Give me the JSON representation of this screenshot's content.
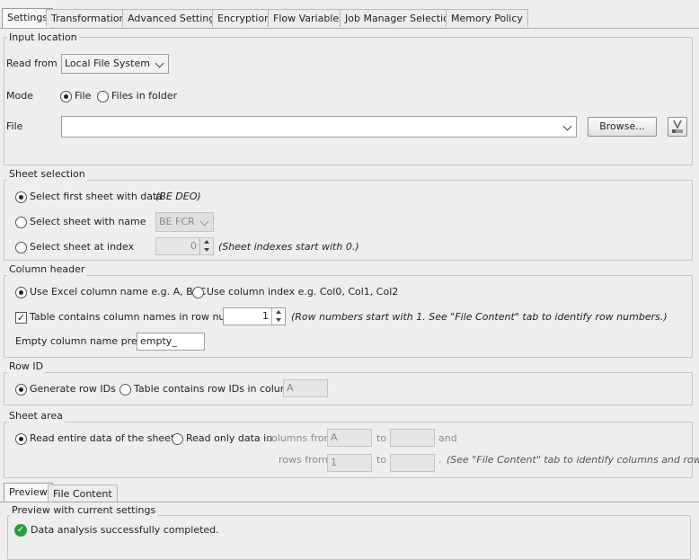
{
  "tabs": [
    "Settings",
    "Transformation",
    "Advanced Settings",
    "Encryption",
    "Flow Variables",
    "Job Manager Selection",
    "Memory Policy"
  ],
  "input_location": {
    "legend": "Input location",
    "read_from_label": "Read from",
    "read_from_value": "Local File System",
    "mode_label": "Mode",
    "mode_file": "File",
    "mode_folder": "Files in folder",
    "file_label": "File",
    "file_value": "",
    "browse_label": "Browse..."
  },
  "sheet_selection": {
    "legend": "Sheet selection",
    "first_sheet_label": "Select first sheet with data",
    "first_sheet_hint": "(BE DEO)",
    "by_name_label": "Select sheet with name",
    "by_name_value": "BE FCR",
    "by_index_label": "Select sheet at index",
    "by_index_value": "0",
    "by_index_hint": "(Sheet indexes start with 0.)"
  },
  "column_header": {
    "legend": "Column header",
    "excel_name_label": "Use Excel column name e.g. A, B, C",
    "index_label": "Use column index e.g. Col0, Col1, Col2",
    "row_number_label": "Table contains column names in row number",
    "row_number_value": "1",
    "row_number_hint": "(Row numbers start with 1. See \"File Content\" tab to identify row numbers.)",
    "prefix_label": "Empty column name prefix:",
    "prefix_value": "empty_"
  },
  "row_id": {
    "legend": "Row ID",
    "generate_label": "Generate row IDs",
    "contains_label": "Table contains row IDs in column",
    "column_value": "A"
  },
  "sheet_area": {
    "legend": "Sheet area",
    "entire_label": "Read entire data of the sheet",
    "only_label": "Read only data in",
    "columns_from_label": "columns from",
    "columns_from_value": "A",
    "to_label": "to",
    "columns_to_value": "",
    "and_label": "and",
    "rows_from_label": "rows from",
    "rows_from_value": "1",
    "rows_to_value": "",
    "hint": "(See \"File Content\" tab to identify columns and rows.)"
  },
  "preview": {
    "tabs": [
      "Preview",
      "File Content"
    ],
    "legend": "Preview with current settings",
    "status": "Data analysis successfully completed."
  }
}
